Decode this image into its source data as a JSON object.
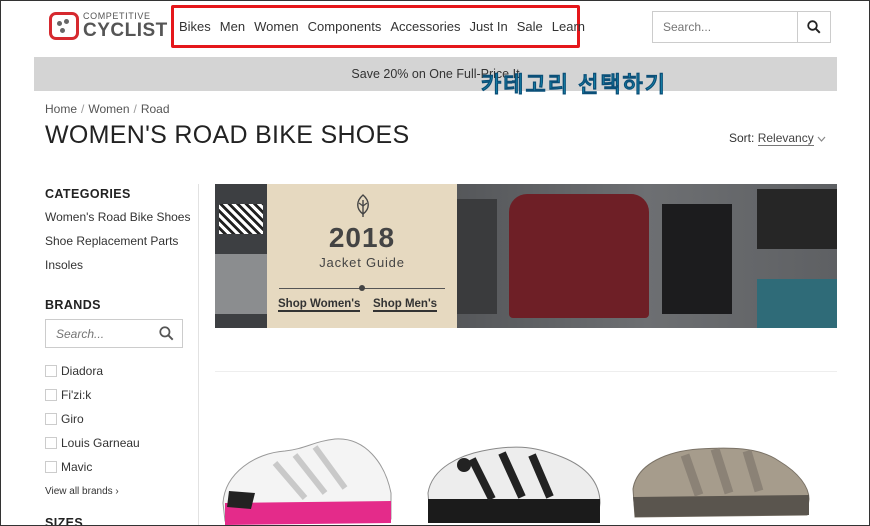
{
  "brand": {
    "small": "COMPETITIVE",
    "big": "CYCLIST"
  },
  "nav": [
    "Bikes",
    "Men",
    "Women",
    "Components",
    "Accessories",
    "Just In",
    "Sale",
    "Learn"
  ],
  "header_search": {
    "placeholder": "Search..."
  },
  "promo": {
    "text": "Save 20% on One Full-Price It"
  },
  "overlay": {
    "text": "카테고리 선택하기"
  },
  "breadcrumb": [
    "Home",
    "Women",
    "Road"
  ],
  "page_title": "WOMEN'S ROAD BIKE SHOES",
  "sort": {
    "label": "Sort:",
    "value": "Relevancy"
  },
  "sidebar": {
    "categories_heading": "CATEGORIES",
    "categories": [
      "Women's Road Bike Shoes",
      "Shoe Replacement Parts",
      "Insoles"
    ],
    "brands_heading": "BRANDS",
    "brand_search_placeholder": "Search...",
    "brands": [
      "Diadora",
      "Fi'zi:k",
      "Giro",
      "Louis Garneau",
      "Mavic"
    ],
    "view_all": "View all brands ›",
    "sizes_heading": "SIZES"
  },
  "banner": {
    "year": "2018",
    "subtitle": "Jacket Guide",
    "shop_women": "Shop Women's",
    "shop_men": "Shop Men's"
  },
  "colors": {
    "accent": "#d6292f",
    "highlight": "#e5171b",
    "promo_bg": "#d4d4d4"
  }
}
